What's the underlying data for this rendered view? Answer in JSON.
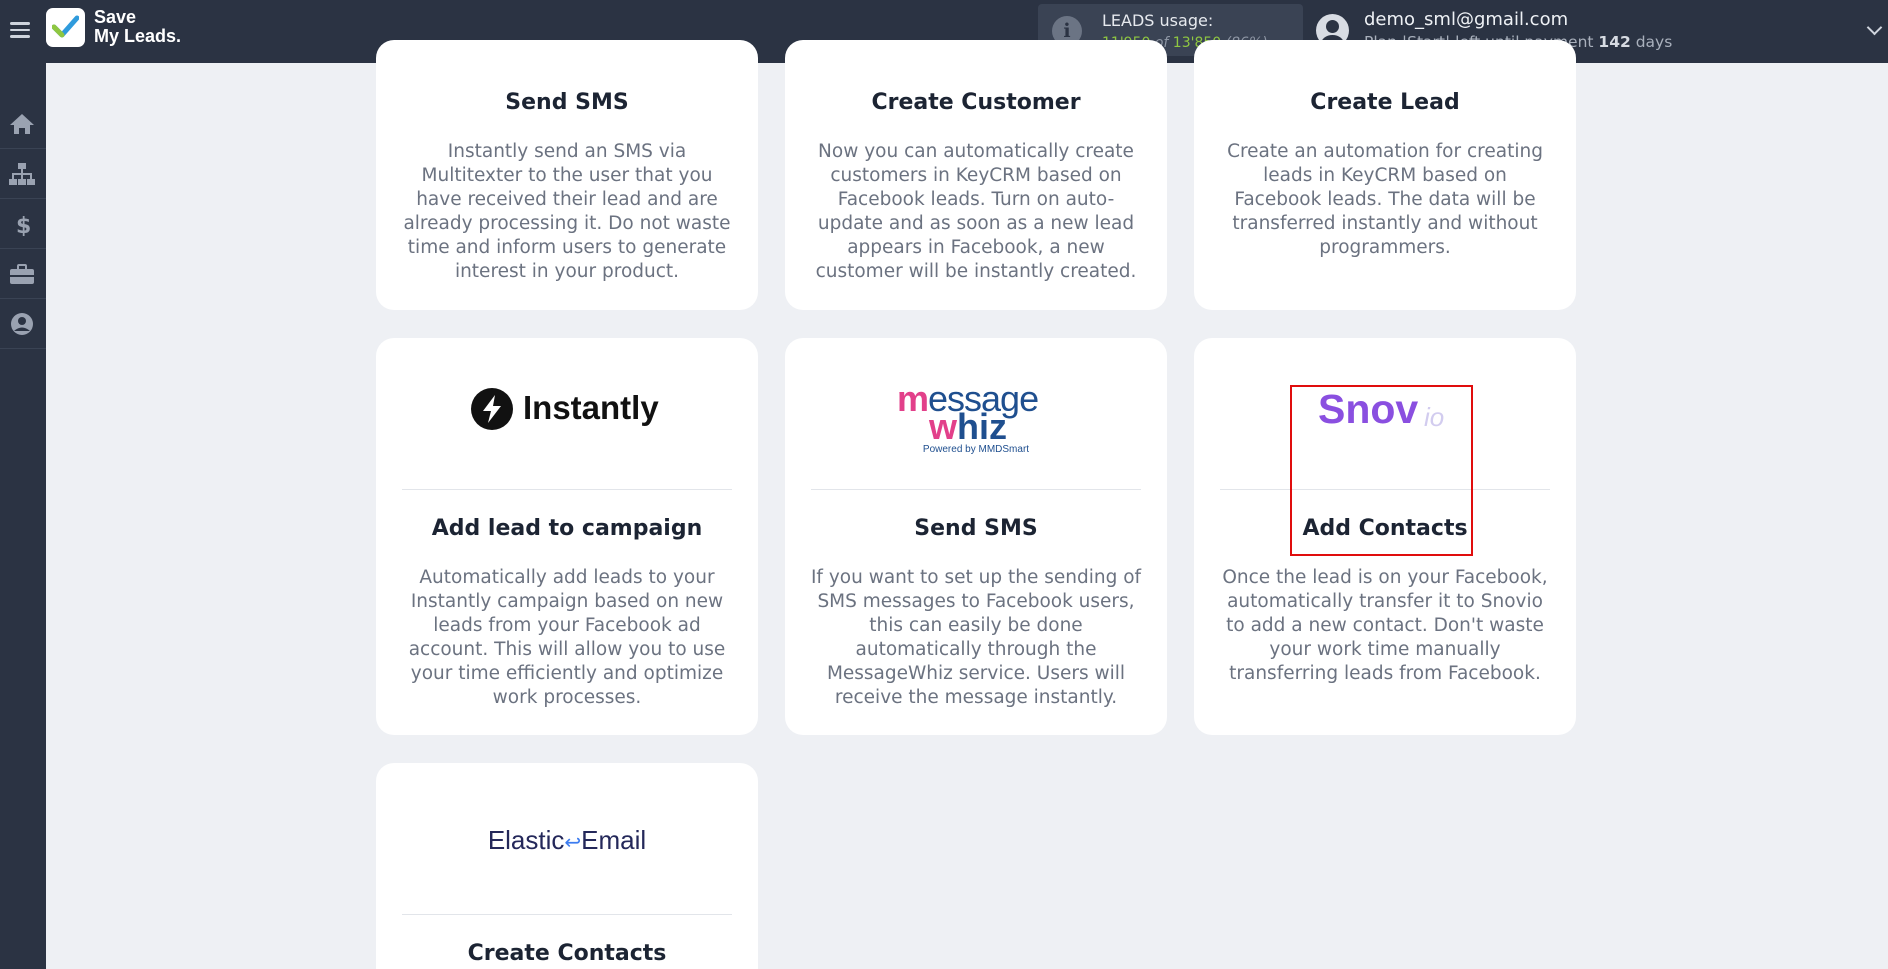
{
  "header": {
    "logo_line1": "Save",
    "logo_line2": "My Leads.",
    "usage_title": "LEADS usage:",
    "usage_used": "11'950",
    "usage_of": "of",
    "usage_total": "13'850",
    "usage_percent": "(86%)",
    "user_email": "demo_sml@gmail.com",
    "plan_text": "Plan |Start| left until payment",
    "plan_days": "142",
    "plan_days_suffix": "days"
  },
  "sidebar": {
    "items": [
      {
        "icon": "home-icon"
      },
      {
        "icon": "sitemap-icon"
      },
      {
        "icon": "dollar-icon"
      },
      {
        "icon": "briefcase-icon"
      },
      {
        "icon": "user-circle-icon"
      }
    ]
  },
  "cards": [
    {
      "title": "Send SMS",
      "desc": "Instantly send an SMS via Multitexter to the user that you have received their lead and are already processing it. Do not waste time and inform users to generate interest in your product."
    },
    {
      "title": "Create Customer",
      "desc": "Now you can automatically create customers in KeyCRM based on Facebook leads. Turn on auto-update and as soon as a new lead appears in Facebook, a new customer will be instantly created."
    },
    {
      "title": "Create Lead",
      "desc": "Create an automation for creating leads in KeyCRM based on Facebook leads. The data will be transferred instantly and without programmers."
    },
    {
      "logo_text": "Instantly",
      "title": "Add lead to campaign",
      "desc": "Automatically add leads to your Instantly campaign based on new leads from your Facebook ad account. This will allow you to use your time efficiently and optimize work processes."
    },
    {
      "logo_line1_m": "m",
      "logo_line1_rest": "essage",
      "logo_line2_w": "w",
      "logo_line2_rest": "hiz",
      "logo_powered": "Powered by MMDSmart",
      "title": "Send SMS",
      "desc": "If you want to set up the sending of SMS messages to Facebook users, this can easily be done automatically through the MessageWhiz service. Users will receive the message instantly."
    },
    {
      "logo_main": "Snov",
      "logo_suffix": "io",
      "title": "Add Contacts",
      "desc": "Once the lead is on your Facebook, automatically transfer it to Snovio to add a new contact. Don't waste your work time manually transferring leads from Facebook."
    },
    {
      "logo_left": "Elastic",
      "logo_right": "Email",
      "title": "Create Contacts"
    }
  ],
  "colors": {
    "topbar": "#2b3343",
    "accent_green": "#8fc741",
    "highlight": "#e00d0d"
  }
}
